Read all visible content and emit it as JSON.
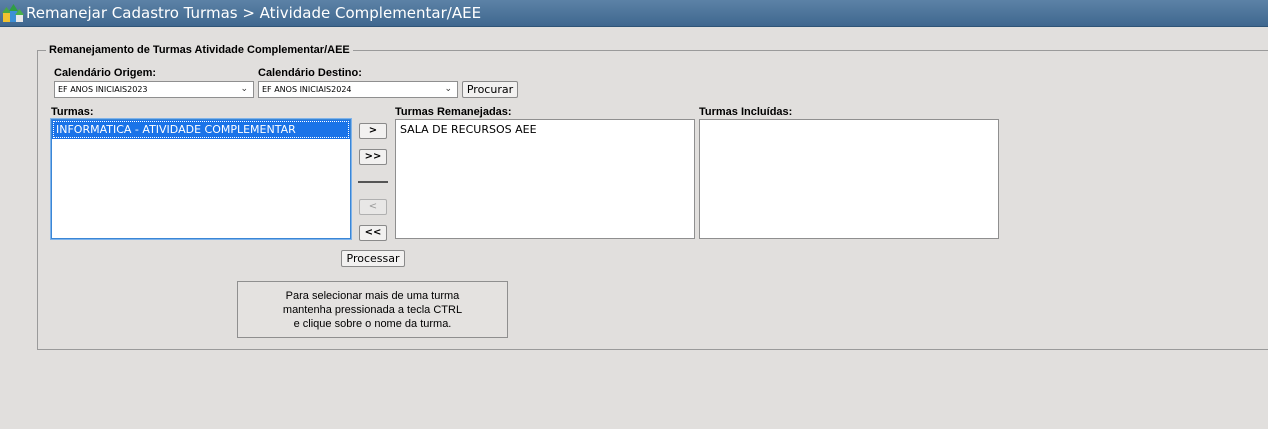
{
  "window": {
    "title": "Remanejar Cadastro Turmas > Atividade Complementar/AEE",
    "icon": "houses-app-icon"
  },
  "form": {
    "legend": "Remanejamento de Turmas Atividade Complementar/AEE",
    "origem": {
      "label": "Calendário Origem:",
      "value": "EF ANOS INICIAIS2023"
    },
    "destino": {
      "label": "Calendário Destino:",
      "value": "EF ANOS INICIAIS2024"
    },
    "search_button": "Procurar"
  },
  "turmas": {
    "label": "Turmas:",
    "items": [
      "INFORMATICA - ATIVIDADE COMPLEMENTAR"
    ],
    "selected_index": 0
  },
  "remanejadas": {
    "label": "Turmas Remanejadas:",
    "items": [
      "SALA DE RECURSOS AEE"
    ]
  },
  "incluidas": {
    "label": "Turmas Incluídas:",
    "items": []
  },
  "transfer": {
    "move_one": ">",
    "move_all": ">>",
    "back_one": "<",
    "back_all": "<<"
  },
  "process_button": "Processar",
  "hint": {
    "line1": "Para selecionar mais de uma turma",
    "line2": "mantenha pressionada a tecla CTRL",
    "line3": "e clique sobre o nome da turma."
  }
}
